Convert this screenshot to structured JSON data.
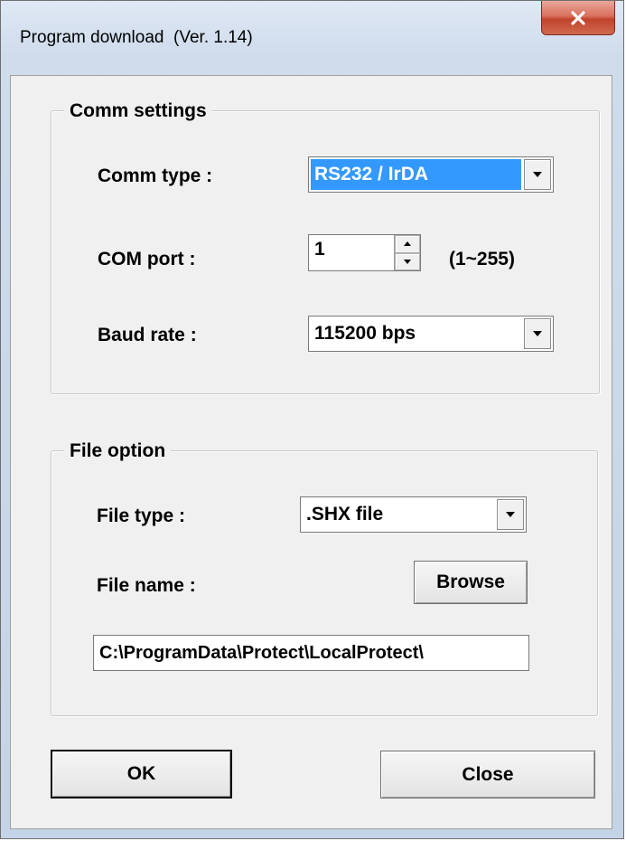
{
  "window": {
    "title": "Program download  (Ver. 1.14)"
  },
  "comm_settings": {
    "legend": "Comm settings",
    "comm_type_label": "Comm type :",
    "comm_type_value": "RS232 / IrDA",
    "com_port_label": "COM port :",
    "com_port_value": "1",
    "com_port_range": "(1~255)",
    "baud_rate_label": "Baud rate :",
    "baud_rate_value": "115200 bps"
  },
  "file_option": {
    "legend": "File option",
    "file_type_label": "File type :",
    "file_type_value": ".SHX file",
    "file_name_label": "File name :",
    "browse_label": "Browse",
    "file_path": "C:\\ProgramData\\Protect\\LocalProtect\\"
  },
  "footer": {
    "ok_label": "OK",
    "close_label": "Close"
  },
  "colors": {
    "selection": "#3399ff",
    "close_button": "#c2432c"
  },
  "icons": {
    "close": "close-icon",
    "dropdown": "chevron-down-icon",
    "spin_up": "spin-up-icon",
    "spin_down": "spin-down-icon"
  }
}
